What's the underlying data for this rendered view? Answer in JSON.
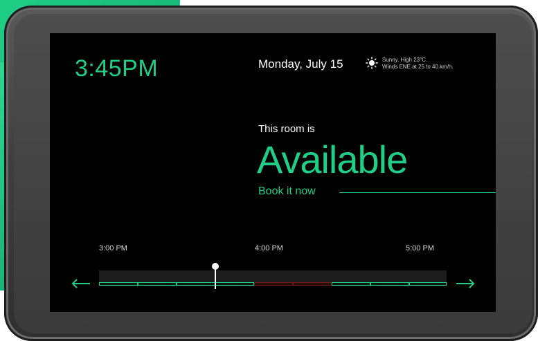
{
  "screen": {
    "time": "3:45PM",
    "date": "Monday, July 15",
    "weather": {
      "icon": "sun-icon",
      "line1": "Sunny. High 23°C.",
      "line2": "Winds ENE at 25 to 40 km/h."
    },
    "room": {
      "label": "This room is",
      "status": "Available",
      "action": "Book it now"
    },
    "timeline": {
      "labels": [
        "3:00 PM",
        "4:00 PM",
        "5:00 PM"
      ],
      "prev_icon": "arrow-left-icon",
      "next_icon": "arrow-right-icon"
    }
  },
  "colors": {
    "accent": "#1fcf86",
    "busy": "#6b1a1a",
    "screen_bg": "#000000"
  }
}
